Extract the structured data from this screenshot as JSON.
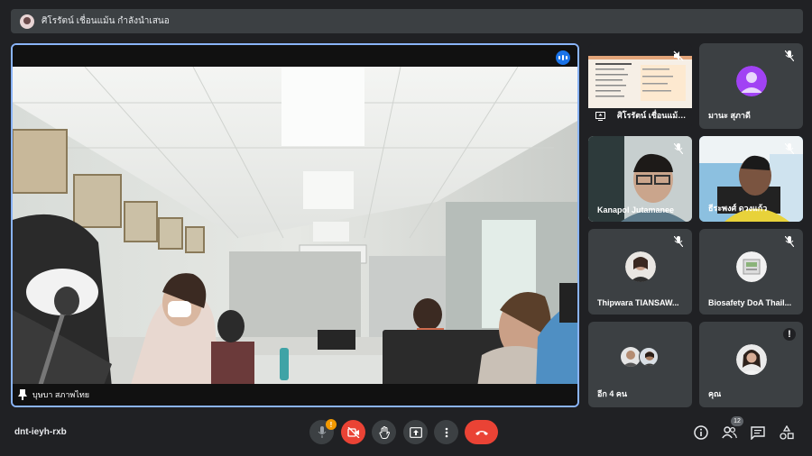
{
  "presenter_bar": {
    "text": "ศิโรรัตน์ เชื่อนแม้น กำลังนำเสนอ"
  },
  "main_tile": {
    "participant_name": "บุษบา สภาพไทย"
  },
  "tiles": [
    {
      "name": "ศิโรรัตน์ เชื่อนแม้น..."
    },
    {
      "name": "มานะ สุภาดี",
      "avatar_color": "#a142f4"
    },
    {
      "name": "Kanapol Jutamanee"
    },
    {
      "name": "ธีระพงศ์ ดวงแก้ว"
    },
    {
      "name": "Thipwara TIANSAW..."
    },
    {
      "name": "Biosafety DoA Thail..."
    },
    {
      "name": "อีก 4 คน"
    },
    {
      "name": "คุณ",
      "alert": "!"
    }
  ],
  "bottom_bar": {
    "meeting_code": "dnt-ieyh-rxb",
    "mic_alert": "!",
    "participants_count": "12"
  },
  "colors": {
    "accent": "#8ab4f8",
    "danger": "#ea4335",
    "warning": "#f29900",
    "tile_bg": "#3c4043"
  }
}
